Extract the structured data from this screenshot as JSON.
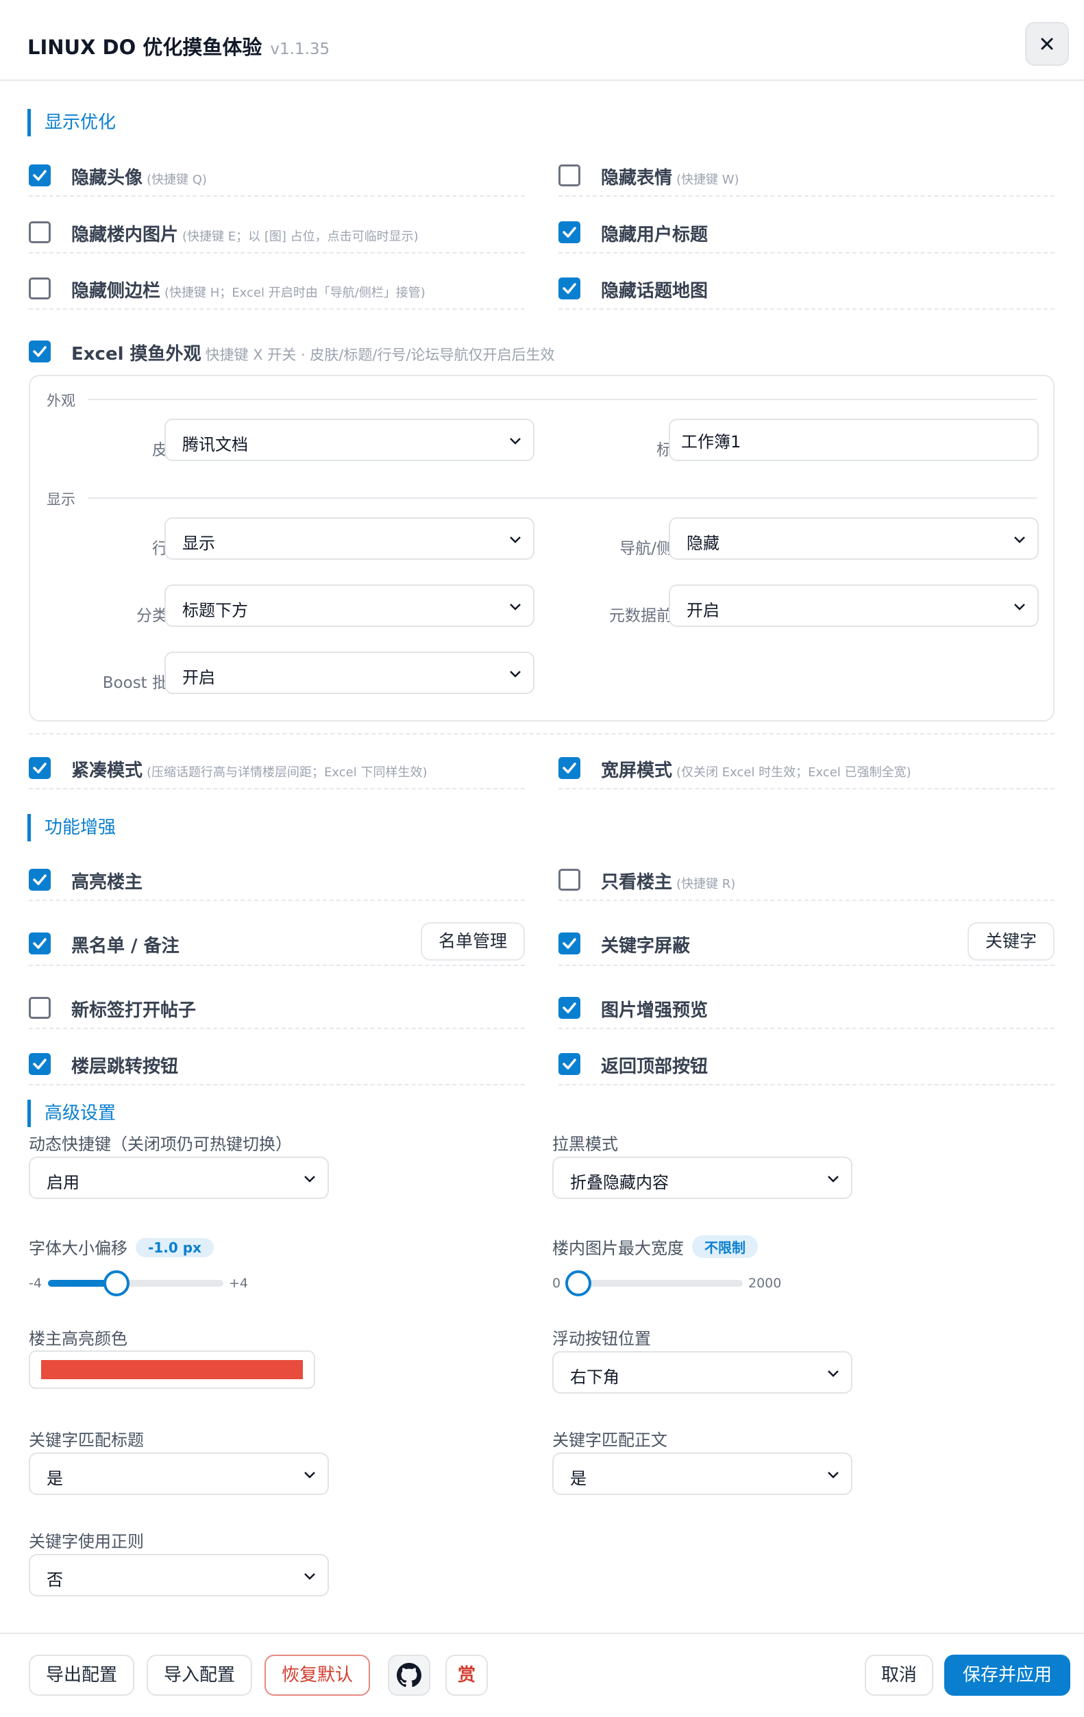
{
  "header": {
    "title": "LINUX DO 优化摸鱼体验",
    "version": "v1.1.35",
    "close_icon": "×"
  },
  "display": {
    "section_title": "显示优化",
    "options": [
      {
        "label": "隐藏头像",
        "hint": "(快捷键 Q)",
        "checked": true
      },
      {
        "label": "隐藏表情",
        "hint": "(快捷键 W)",
        "checked": false
      },
      {
        "label": "隐藏楼内图片",
        "hint": "(快捷键 E；以 [图] 占位，点击可临时显示)",
        "checked": false
      },
      {
        "label": "隐藏用户标题",
        "hint": "",
        "checked": true
      },
      {
        "label": "隐藏侧边栏",
        "hint": "(快捷键 H；Excel 开启时由「导航/侧栏」接管)",
        "checked": false
      },
      {
        "label": "隐藏话题地图",
        "hint": "",
        "checked": true
      }
    ],
    "excel": {
      "label": "Excel 摸鱼外观",
      "hint": "快捷键 X 开关 · 皮肤/标题/行号/论坛导航仅开启后生效",
      "checked": true,
      "appearance_group": "外观",
      "skin_label": "皮肤",
      "skin_value": "腾讯文档",
      "title_label": "标题",
      "title_value": "工作簿1",
      "display_group": "显示",
      "row_number_label": "行号",
      "row_number_value": "显示",
      "nav_label": "导航/侧栏",
      "nav_value": "隐藏",
      "category_label": "分类列",
      "category_value": "标题下方",
      "metadata_label": "元数据前置",
      "metadata_value": "开启",
      "boost_label": "Boost 批注",
      "boost_value": "开启"
    },
    "compact": {
      "label": "紧凑模式",
      "hint": "(压缩话题行高与详情楼层间距；Excel 下同样生效)",
      "checked": true
    },
    "widescreen": {
      "label": "宽屏模式",
      "hint": "(仅关闭 Excel 时生效；Excel 已强制全宽)",
      "checked": true
    }
  },
  "features": {
    "section_title": "功能增强",
    "options": [
      {
        "label": "高亮楼主",
        "hint": "",
        "checked": true
      },
      {
        "label": "只看楼主",
        "hint": "(快捷键 R)",
        "checked": false
      },
      {
        "label": "黑名单 / 备注",
        "hint": "",
        "checked": true,
        "button": "名单管理"
      },
      {
        "label": "关键字屏蔽",
        "hint": "",
        "checked": true,
        "button": "关键字"
      },
      {
        "label": "新标签打开帖子",
        "hint": "",
        "checked": false
      },
      {
        "label": "图片增强预览",
        "hint": "",
        "checked": true
      },
      {
        "label": "楼层跳转按钮",
        "hint": "",
        "checked": true
      },
      {
        "label": "返回顶部按钮",
        "hint": "",
        "checked": true
      }
    ]
  },
  "advanced": {
    "section_title": "高级设置",
    "hotkeys_label": "动态快捷键（关闭项仍可热键切换）",
    "hotkeys_value": "启用",
    "block_mode_label": "拉黑模式",
    "block_mode_value": "折叠隐藏内容",
    "font_offset_label": "字体大小偏移",
    "font_offset_badge": "-1.0 px",
    "font_offset_min": "-4",
    "font_offset_max": "+4",
    "font_offset_fraction": 0.375,
    "img_width_label": "楼内图片最大宽度",
    "img_width_badge": "不限制",
    "img_width_min": "0",
    "img_width_max": "2000",
    "img_width_fraction": 0.0,
    "op_color_label": "楼主高亮颜色",
    "op_color": "#e74c3c",
    "float_pos_label": "浮动按钮位置",
    "float_pos_value": "右下角",
    "kw_title_label": "关键字匹配标题",
    "kw_title_value": "是",
    "kw_body_label": "关键字匹配正文",
    "kw_body_value": "是",
    "kw_regex_label": "关键字使用正则",
    "kw_regex_value": "否"
  },
  "footer": {
    "export": "导出配置",
    "import": "导入配置",
    "reset": "恢复默认",
    "github_icon": "github-icon",
    "reward": "赏",
    "cancel": "取消",
    "save": "保存并应用"
  },
  "colors": {
    "accent": "#0a7fd0",
    "danger": "#d23c2e"
  }
}
